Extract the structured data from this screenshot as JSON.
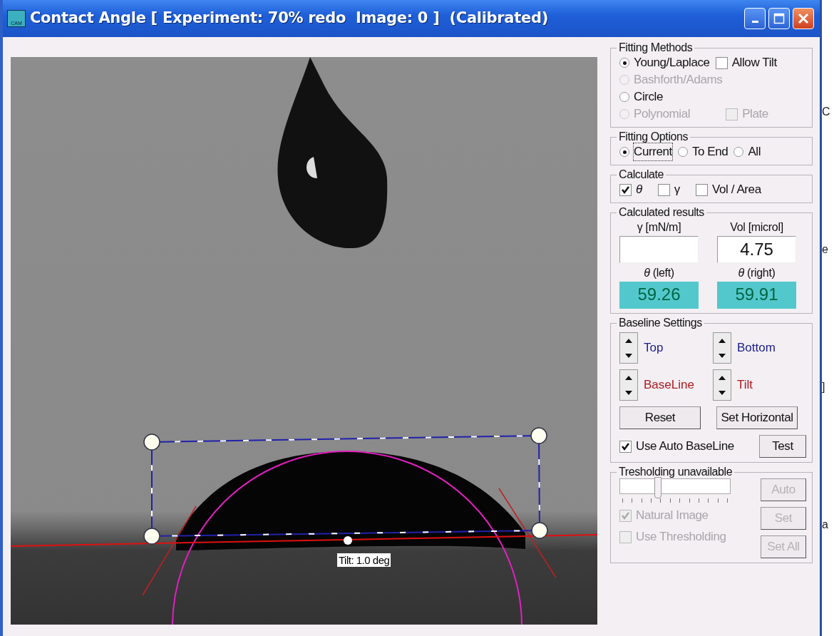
{
  "window": {
    "icon_label": "CAM",
    "title": "Contact Angle [ Experiment: 70% redo  Image: 0 ]  (Calibrated)"
  },
  "image_view": {
    "tilt_label": "Tilt: 1.0 deg"
  },
  "fitting_methods": {
    "title": "Fitting Methods",
    "options": [
      {
        "label": "Young/Laplace",
        "selected": true,
        "disabled": false
      },
      {
        "label": "Bashforth/Adams",
        "selected": false,
        "disabled": true
      },
      {
        "label": "Circle",
        "selected": false,
        "disabled": false
      },
      {
        "label": "Polynomial",
        "selected": false,
        "disabled": true
      }
    ],
    "checkboxes": [
      {
        "label": "Allow Tilt",
        "checked": false,
        "disabled": false
      },
      {
        "label": "Plate",
        "checked": false,
        "disabled": true
      }
    ]
  },
  "fitting_options": {
    "title": "Fitting Options",
    "options": [
      {
        "label": "Current",
        "selected": true
      },
      {
        "label": "To End",
        "selected": false
      },
      {
        "label": "All",
        "selected": false
      }
    ]
  },
  "calculate": {
    "title": "Calculate",
    "checkboxes": [
      {
        "label": "θ",
        "checked": true
      },
      {
        "label": "γ",
        "checked": false
      },
      {
        "label": "Vol / Area",
        "checked": false
      }
    ]
  },
  "results": {
    "title": "Calculated results",
    "fields": [
      {
        "label": "γ [mN/m]",
        "kind": "plain"
      },
      {
        "label": "Vol [microl]",
        "value": "4.75",
        "kind": "plain"
      },
      {
        "label": "*θ*  (left)",
        "value": "59.26",
        "kind": "highlight"
      },
      {
        "label": "*θ*  (right)",
        "value": "59.91",
        "kind": "highlight"
      }
    ]
  },
  "baseline": {
    "title": "Baseline Settings",
    "spinners": [
      {
        "label": "Top",
        "color": "#1c1c8a"
      },
      {
        "label": "Bottom",
        "color": "#1c1c8a"
      },
      {
        "label": "BaseLine",
        "color": "#b0191e"
      },
      {
        "label": "Tilt",
        "color": "#b0191e"
      }
    ],
    "buttons": [
      "Reset",
      "Set Horizontal"
    ],
    "auto_baseline": {
      "label": "Use Auto BaseLine",
      "checked": true
    },
    "test_button": "Test"
  },
  "thresholding": {
    "title": "Tresholding unavailable",
    "disabled": true,
    "slider": {
      "level": 0.33
    },
    "buttons": [
      "Auto",
      "Set",
      "Set All"
    ],
    "checkboxes": [
      {
        "label": "Natural Image",
        "checked": true
      },
      {
        "label": "Use Thresholding",
        "checked": false
      }
    ]
  },
  "background_window": {
    "fragments": [
      "C",
      "e",
      "]",
      "a"
    ]
  }
}
